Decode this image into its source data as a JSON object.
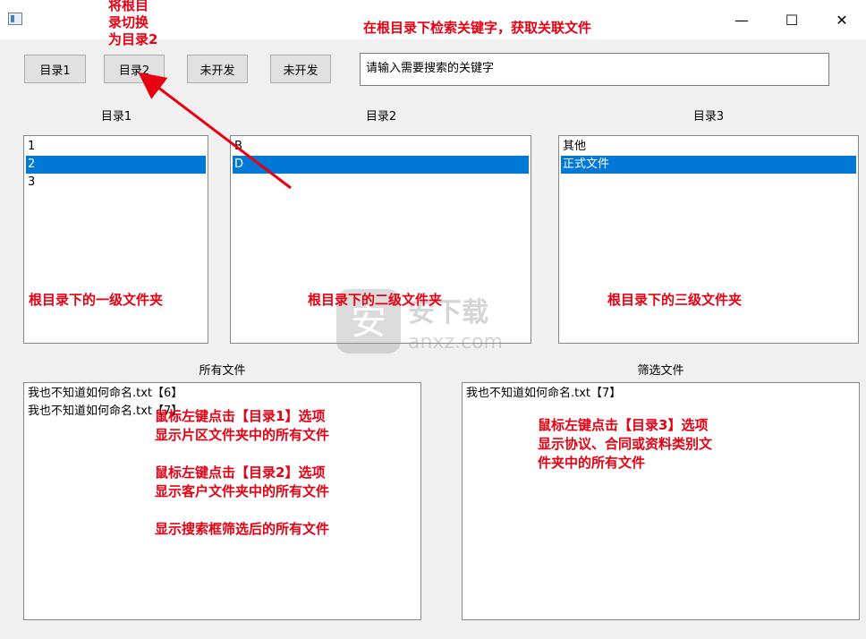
{
  "window": {
    "minimize_glyph": "—",
    "maximize_glyph": "☐",
    "close_glyph": "✕"
  },
  "toolbar": {
    "buttons": [
      "目录1",
      "目录2",
      "未开发",
      "未开发"
    ],
    "search_placeholder": "请输入需要搜索的关键字"
  },
  "lists": {
    "dir1": {
      "label": "目录1",
      "items": [
        "1",
        "2",
        "3"
      ],
      "selected_index": 1
    },
    "dir2": {
      "label": "目录2",
      "items": [
        "B",
        "D"
      ],
      "selected_index": 1
    },
    "dir3": {
      "label": "目录3",
      "items": [
        "其他",
        "正式文件"
      ],
      "selected_index": 1
    },
    "all_files": {
      "label": "所有文件",
      "items": [
        "我也不知道如何命名.txt【6】",
        "我也不知道如何命名.txt【7】"
      ]
    },
    "filtered_files": {
      "label": "筛选文件",
      "items": [
        "我也不知道如何命名.txt【7】"
      ]
    }
  },
  "annotations": {
    "switch_root": [
      "将根目",
      "录切换",
      "为目录2"
    ],
    "search_hint": "在根目录下检索关键字，获取关联文件",
    "level1": "根目录下的一级文件夹",
    "level2": "根目录下的二级文件夹",
    "level3": "根目录下的三级文件夹",
    "all_files_notes": [
      "鼠标左键点击【目录1】选项",
      "显示片区文件夹中的所有文件",
      "",
      "鼠标左键点击【目录2】选项",
      "显示客户文件夹中的所有文件",
      "",
      "显示搜索框筛选后的所有文件"
    ],
    "filtered_notes": [
      "鼠标左键点击【目录3】选项",
      "显示协议、合同或资料类别文",
      "件夹中的所有文件"
    ]
  },
  "watermark": {
    "brand": "安下载",
    "domain": "anxz.com",
    "glyph": "安"
  },
  "colors": {
    "accent": "#e60012",
    "selection": "#0078d7"
  }
}
